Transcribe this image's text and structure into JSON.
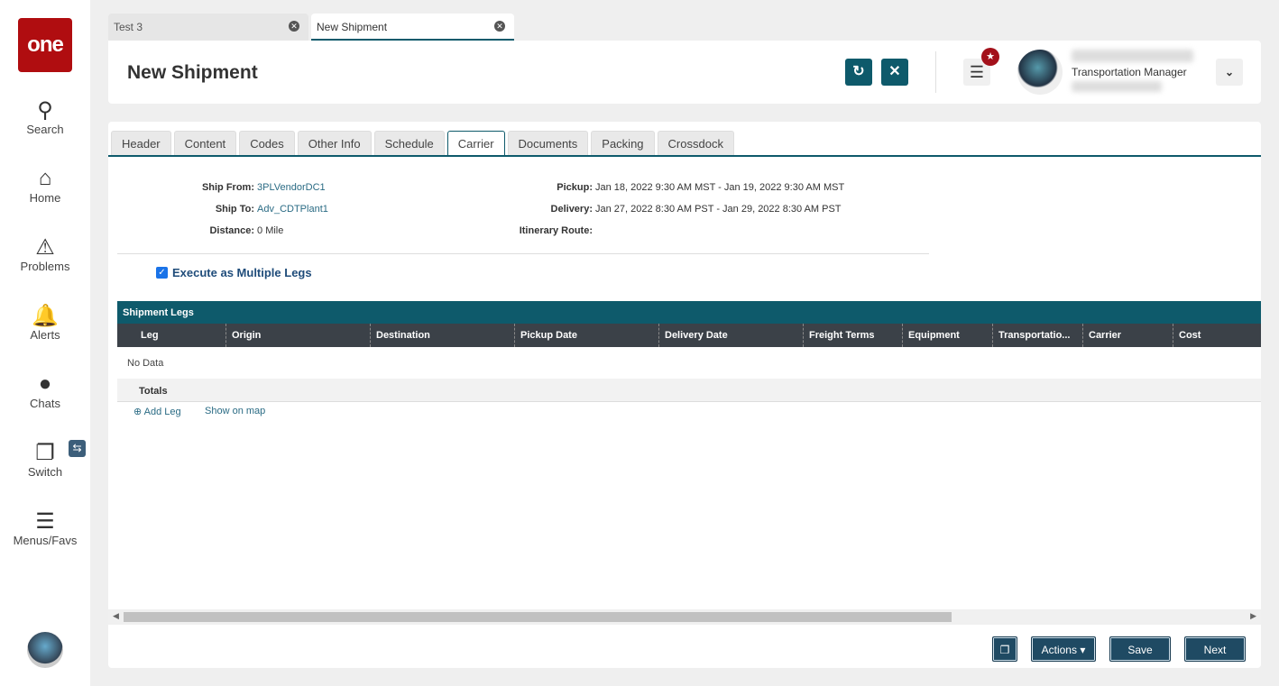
{
  "sidebar": {
    "logo": "one",
    "items": [
      {
        "label": "Search",
        "icon": "search-icon"
      },
      {
        "label": "Home",
        "icon": "home-icon"
      },
      {
        "label": "Problems",
        "icon": "warning-icon"
      },
      {
        "label": "Alerts",
        "icon": "bell-icon"
      },
      {
        "label": "Chats",
        "icon": "chat-icon"
      },
      {
        "label": "Switch",
        "icon": "switch-icon"
      },
      {
        "label": "Menus/Favs",
        "icon": "menu-icon"
      }
    ]
  },
  "top_tabs": [
    {
      "label": "Test 3"
    },
    {
      "label": "New Shipment",
      "active": true
    }
  ],
  "header": {
    "title": "New Shipment",
    "user_role": "Transportation Manager"
  },
  "tabs": [
    "Header",
    "Content",
    "Codes",
    "Other Info",
    "Schedule",
    "Carrier",
    "Documents",
    "Packing",
    "Crossdock"
  ],
  "active_tab": "Carrier",
  "info": {
    "ship_from_label": "Ship From:",
    "ship_from": "3PLVendorDC1",
    "ship_to_label": "Ship To:",
    "ship_to": "Adv_CDTPlant1",
    "distance_label": "Distance:",
    "distance": "0",
    "distance_unit": "Mile",
    "pickup_label": "Pickup:",
    "pickup": "Jan 18, 2022 9:30 AM MST - Jan 19, 2022 9:30 AM MST",
    "delivery_label": "Delivery:",
    "delivery": "Jan 27, 2022 8:30 AM PST - Jan 29, 2022 8:30 AM PST",
    "itinerary_label": "Itinerary Route:"
  },
  "execute_multiple_legs": {
    "label": "Execute as Multiple Legs",
    "checked": true
  },
  "grid": {
    "title": "Shipment Legs",
    "columns": [
      "Leg",
      "Origin",
      "Destination",
      "Pickup Date",
      "Delivery Date",
      "Freight Terms",
      "Equipment",
      "Transportatio...",
      "Carrier",
      "Cost"
    ],
    "empty": "No Data",
    "totals": "Totals"
  },
  "links": {
    "add_leg": "Add Leg",
    "show_on_map": "Show on map"
  },
  "footer": {
    "actions": "Actions",
    "save": "Save",
    "next": "Next"
  }
}
